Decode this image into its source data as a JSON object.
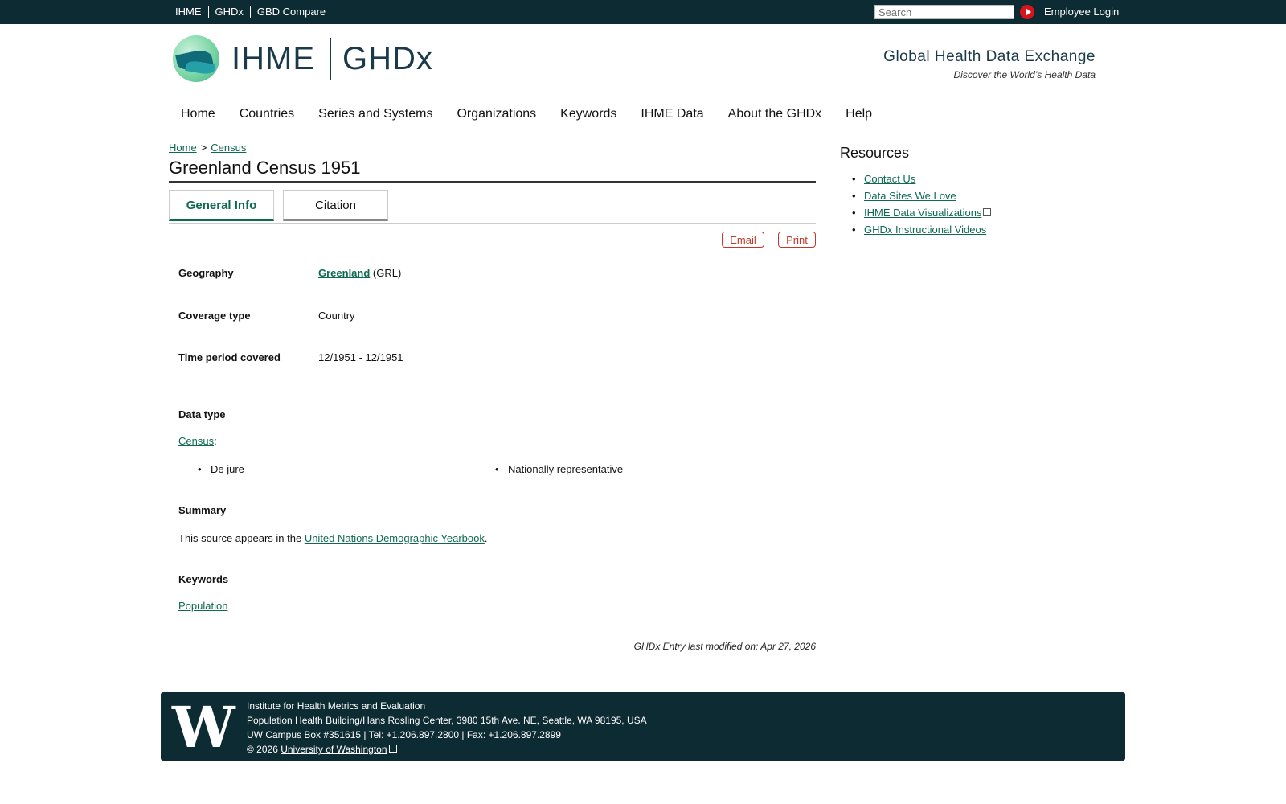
{
  "topbar": {
    "links": [
      "IHME",
      "GHDx",
      "GBD Compare"
    ],
    "search_placeholder": "Search",
    "login": "Employee Login"
  },
  "header": {
    "brand_left": "IHME",
    "brand_right": "GHDx",
    "tagline_title": "Global Health Data Exchange",
    "tagline_sub": "Discover the World’s Health Data"
  },
  "nav": [
    "Home",
    "Countries",
    "Series and Systems",
    "Organizations",
    "Keywords",
    "IHME Data",
    "About the GHDx",
    "Help"
  ],
  "breadcrumb": {
    "home": "Home",
    "sep": ">",
    "current": "Census"
  },
  "page": {
    "title": "Greenland Census 1951",
    "tabs": [
      "General Info",
      "Citation"
    ],
    "email": "Email",
    "print": "Print"
  },
  "info": {
    "geography_label": "Geography",
    "geography_link": "Greenland",
    "geography_code": "(GRL)",
    "coverage_label": "Coverage type",
    "coverage_value": "Country",
    "time_label": "Time period covered",
    "time_value": "12/1951 - 12/1951"
  },
  "data_type": {
    "heading": "Data type",
    "link": "Census",
    "colon": ":",
    "items": [
      "De jure",
      "Nationally representative"
    ]
  },
  "summary": {
    "heading": "Summary",
    "text_before": "This source appears in the ",
    "link": "United Nations Demographic Yearbook",
    "text_after": "."
  },
  "keywords": {
    "heading": "Keywords",
    "link": "Population"
  },
  "modified": "GHDx Entry last modified on: Apr 27, 2026",
  "sidebar": {
    "heading": "Resources",
    "links": [
      "Contact Us",
      "Data Sites We Love",
      "IHME Data Visualizations",
      "GHDx Instructional Videos"
    ]
  },
  "footer": {
    "logo": "W",
    "line1": "Institute for Health Metrics and Evaluation",
    "line2": "Population Health Building/Hans Rosling Center, 3980 15th Ave. NE, Seattle, WA 98195, USA",
    "line3": "UW Campus Box #351615 | Tel: +1.206.897.2800 | Fax: +1.206.897.2899",
    "copyright": "© 2026 ",
    "uw_link": "University of Washington"
  }
}
